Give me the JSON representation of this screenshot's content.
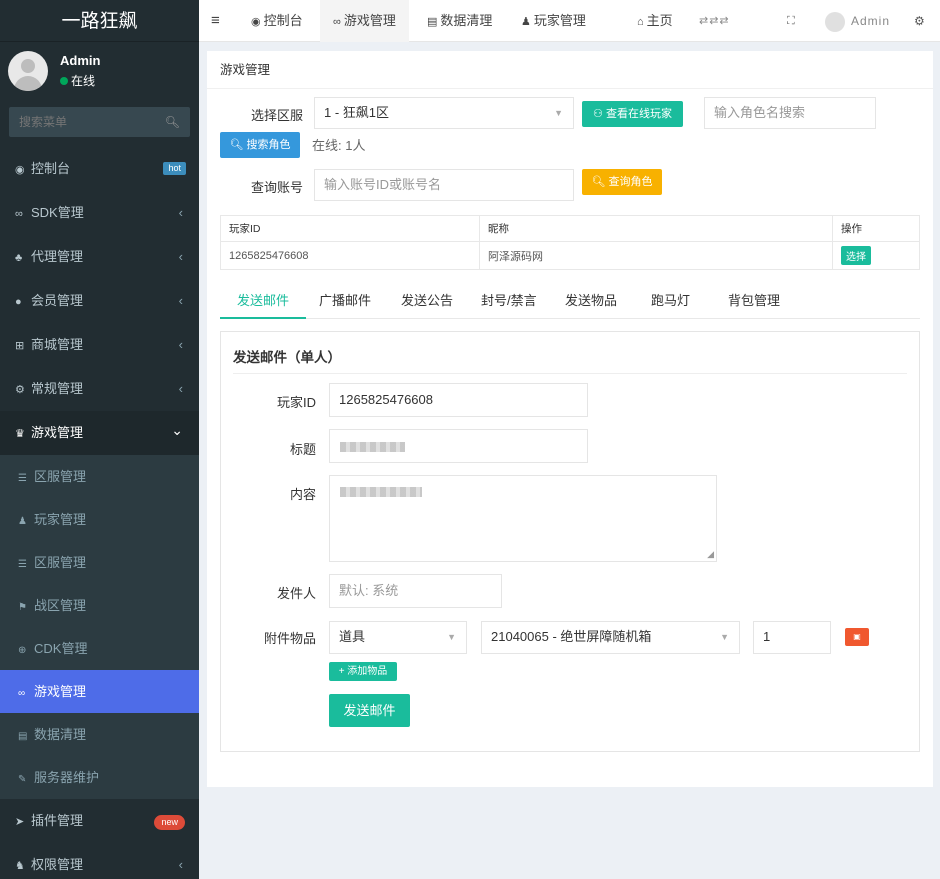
{
  "sidebar": {
    "logo": "一路狂飙",
    "user": {
      "name": "Admin",
      "status": "在线"
    },
    "search_placeholder": "搜索菜单",
    "items": [
      {
        "label": "控制台",
        "icon": "dashboard-icon",
        "badge": "hot"
      },
      {
        "label": "SDK管理",
        "icon": "link-icon",
        "arrow": "‹"
      },
      {
        "label": "代理管理",
        "icon": "sitemap-icon",
        "arrow": "‹"
      },
      {
        "label": "会员管理",
        "icon": "user-circle-icon",
        "arrow": "‹"
      },
      {
        "label": "商城管理",
        "icon": "cart-icon",
        "arrow": "‹"
      },
      {
        "label": "常规管理",
        "icon": "cogs-icon",
        "arrow": "‹"
      },
      {
        "label": "游戏管理",
        "icon": "trophy-icon",
        "arrow": "⌄"
      }
    ],
    "subitems": [
      {
        "label": "区服管理",
        "icon": "list-icon"
      },
      {
        "label": "玩家管理",
        "icon": "user-icon"
      },
      {
        "label": "区服管理",
        "icon": "list-icon"
      },
      {
        "label": "战区管理",
        "icon": "flag-icon"
      },
      {
        "label": "CDK管理",
        "icon": "gift-icon"
      },
      {
        "label": "游戏管理",
        "icon": "gamepad-icon"
      },
      {
        "label": "数据清理",
        "icon": "trash-icon"
      },
      {
        "label": "服务器维护",
        "icon": "wrench-icon"
      }
    ],
    "bottom": [
      {
        "label": "插件管理",
        "icon": "rocket-icon",
        "badge": "new"
      },
      {
        "label": "权限管理",
        "icon": "group-icon",
        "arrow": "‹"
      }
    ]
  },
  "topbar": {
    "tabs": [
      {
        "label": "控制台",
        "icon": "dashboard-icon"
      },
      {
        "label": "游戏管理",
        "icon": "gamepad-icon"
      },
      {
        "label": "数据清理",
        "icon": "trash-icon"
      },
      {
        "label": "玩家管理",
        "icon": "user-icon"
      }
    ],
    "home": "主页",
    "user": "Admin"
  },
  "page": {
    "title": "游戏管理",
    "zone_label": "选择区服",
    "zone_value": "1 - 狂飙1区",
    "view_online_btn": "查看在线玩家",
    "role_search_placeholder": "输入角色名搜索",
    "search_role_btn": "搜索角色",
    "online": "在线: 1人",
    "account_label": "查询账号",
    "account_placeholder": "输入账号ID或账号名",
    "query_role_btn": "查询角色",
    "table": {
      "headers": [
        "玩家ID",
        "昵称",
        "操作"
      ],
      "rows": [
        {
          "id": "1265825476608",
          "nick": "阿泽源码网",
          "action": "选择"
        }
      ]
    },
    "tabs": [
      "发送邮件",
      "广播邮件",
      "发送公告",
      "封号/禁言",
      "发送物品",
      "跑马灯",
      "背包管理"
    ],
    "form": {
      "title": "发送邮件（单人）",
      "player_id_label": "玩家ID",
      "player_id_value": "1265825476608",
      "subject_label": "标题",
      "content_label": "内容",
      "sender_label": "发件人",
      "sender_placeholder": "默认: 系统",
      "attach_label": "附件物品",
      "attach_type": "道具",
      "attach_item": "21040065 - 绝世屏障随机箱",
      "attach_qty": "1",
      "add_item_btn": "+ 添加物品",
      "submit_btn": "发送邮件"
    }
  },
  "colors": {
    "accent": "#1abc9c",
    "sidebar_active": "#4e6ce8",
    "sidebar_bg": "#222d32"
  }
}
